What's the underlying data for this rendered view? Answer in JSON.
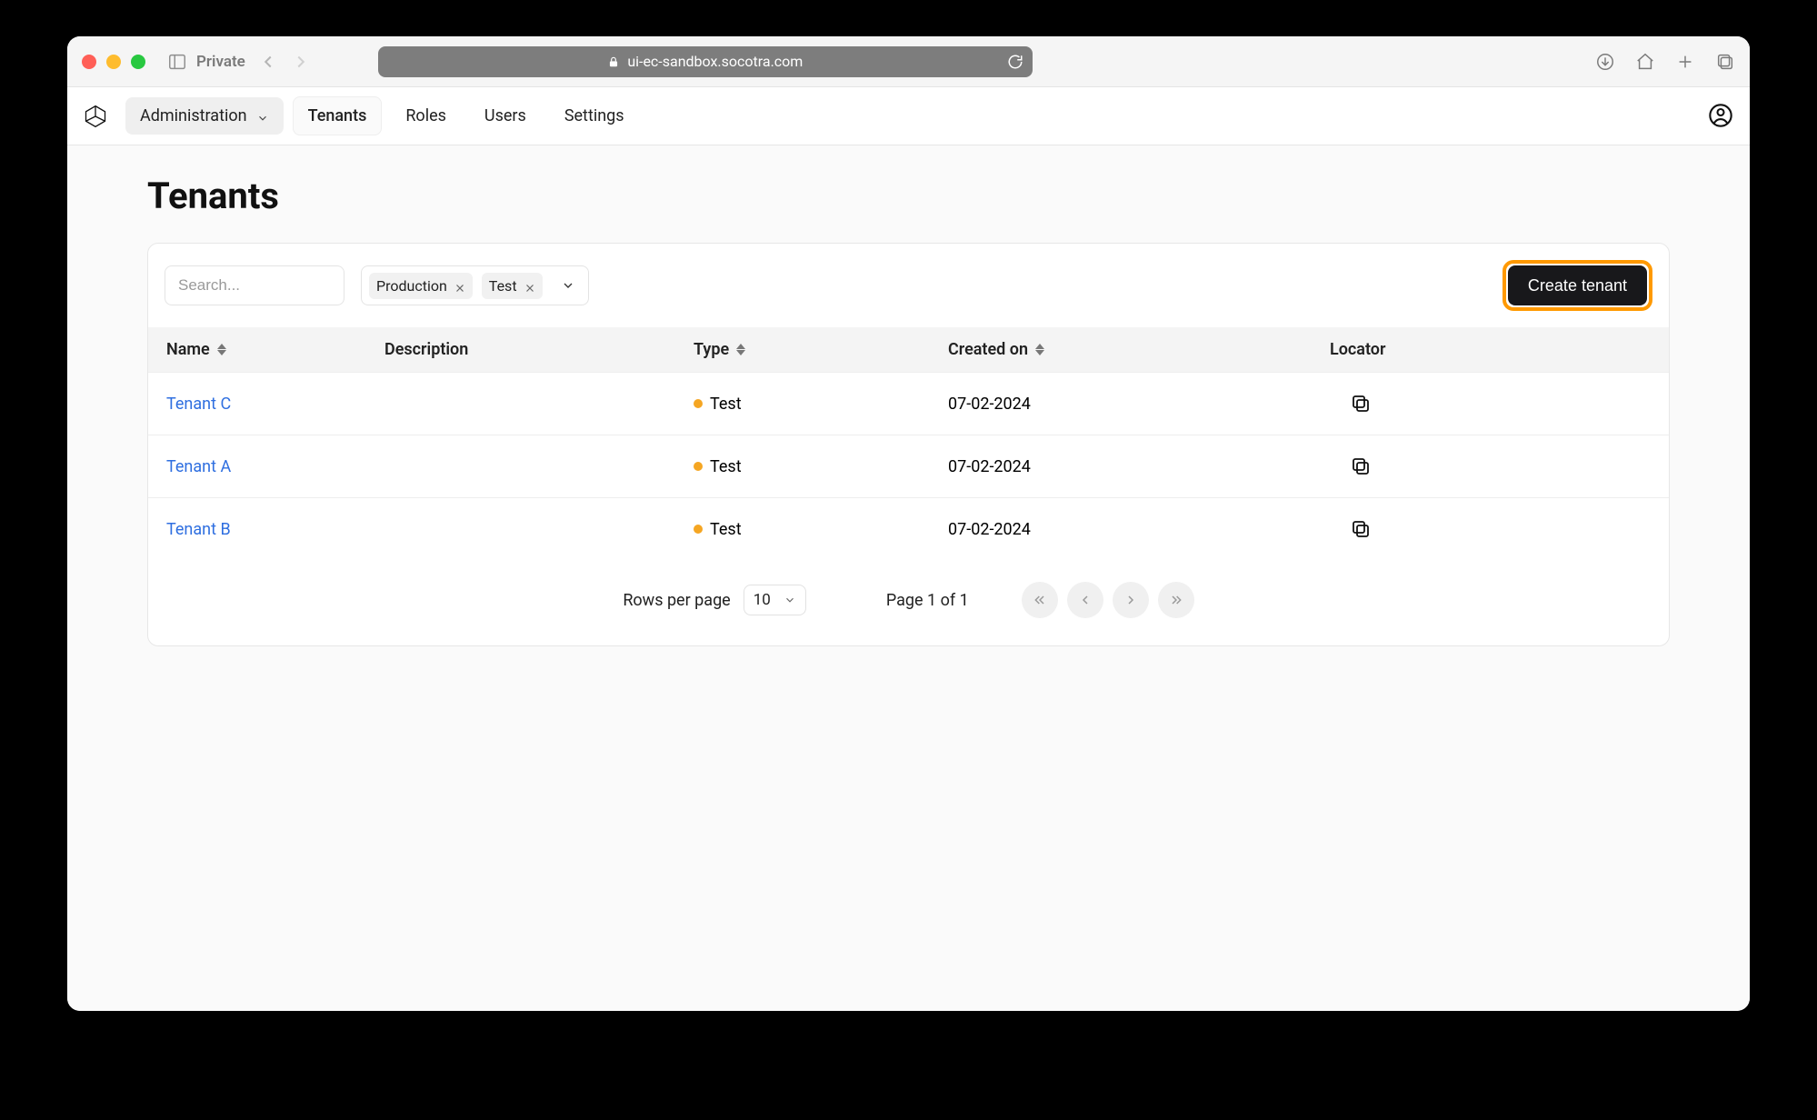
{
  "browser": {
    "private_label": "Private",
    "url": "ui-ec-sandbox.socotra.com"
  },
  "nav": {
    "admin_label": "Administration",
    "items": [
      "Tenants",
      "Roles",
      "Users",
      "Settings"
    ]
  },
  "page": {
    "title": "Tenants"
  },
  "toolbar": {
    "search_placeholder": "Search...",
    "filters": [
      "Production",
      "Test"
    ],
    "create_label": "Create tenant"
  },
  "table": {
    "headers": {
      "name": "Name",
      "description": "Description",
      "type": "Type",
      "created": "Created on",
      "locator": "Locator"
    },
    "rows": [
      {
        "name": "Tenant C",
        "description": "",
        "type": "Test",
        "created": "07-02-2024"
      },
      {
        "name": "Tenant A",
        "description": "",
        "type": "Test",
        "created": "07-02-2024"
      },
      {
        "name": "Tenant B",
        "description": "",
        "type": "Test",
        "created": "07-02-2024"
      }
    ]
  },
  "footer": {
    "rows_per_page_label": "Rows per page",
    "rows_per_page_value": "10",
    "page_info": "Page 1 of 1"
  }
}
